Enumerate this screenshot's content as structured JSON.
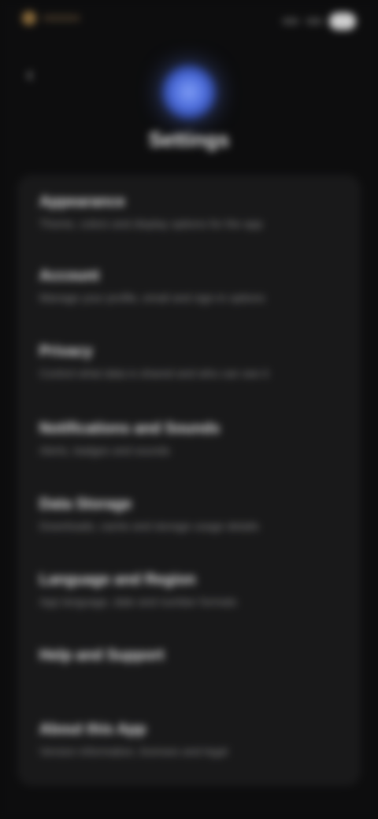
{
  "page": {
    "title": "Settings"
  },
  "status_bar": {
    "time": "9:41"
  },
  "icons": {
    "back": "arrow-left-icon",
    "logo": "app-logo-icon"
  },
  "colors": {
    "background": "#0d0d0e",
    "card": "#19191a",
    "accent": "#5b7ce6"
  },
  "settings": [
    {
      "title": "Appearance",
      "description": "Theme, colors and display options for the app"
    },
    {
      "title": "Account",
      "description": "Manage your profile, email and sign-in options"
    },
    {
      "title": "Privacy",
      "description": "Control what data is shared and who can see it"
    },
    {
      "title": "Notifications and Sounds",
      "description": "Alerts, badges and sounds"
    },
    {
      "title": "Data Storage",
      "description": "Downloads, cache and storage usage details"
    },
    {
      "title": "Language and Region",
      "description": "App language, date and number formats"
    },
    {
      "title": "Help and Support",
      "description": ""
    },
    {
      "title": "About this App",
      "description": "Version information, licenses and legal"
    }
  ]
}
